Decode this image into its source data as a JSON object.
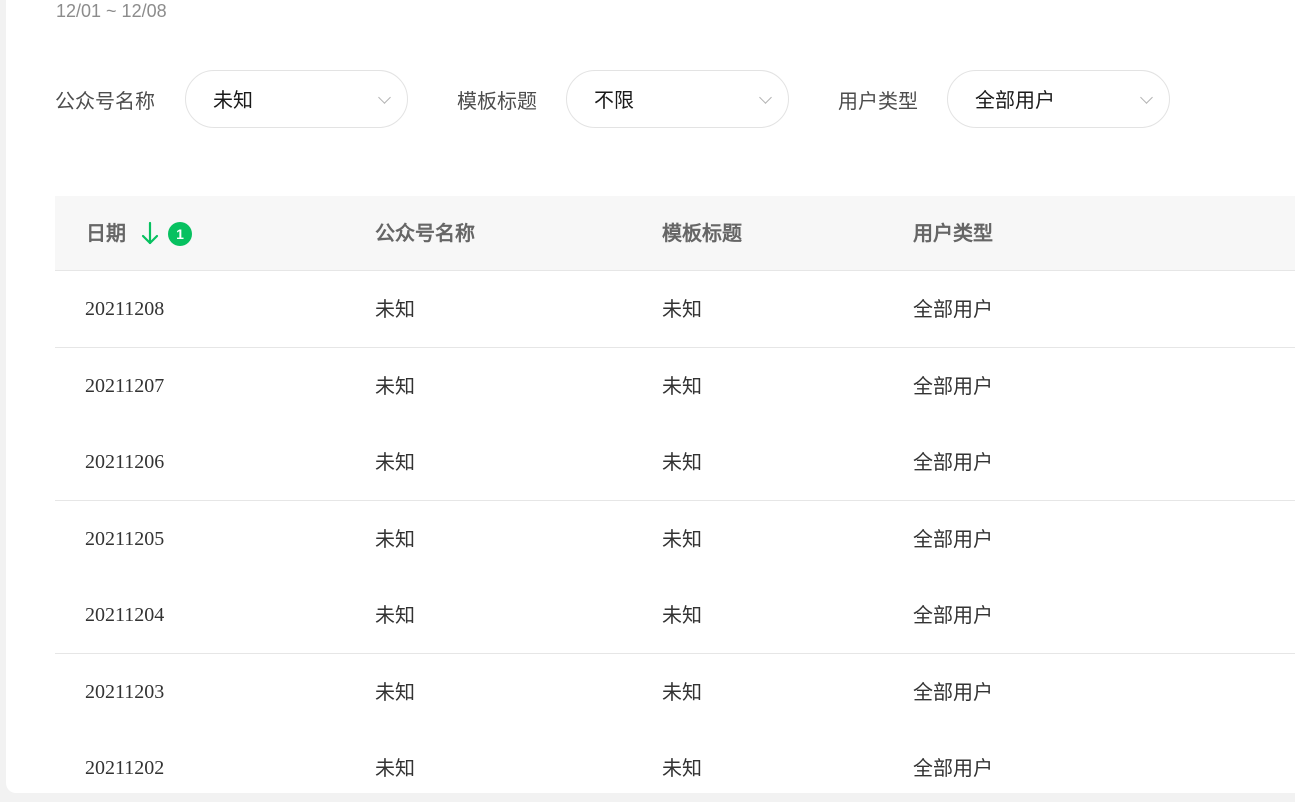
{
  "date_range": "12/01 ~ 12/08",
  "filters": [
    {
      "label": "公众号名称",
      "value": "未知"
    },
    {
      "label": "模板标题",
      "value": "不限"
    },
    {
      "label": "用户类型",
      "value": "全部用户"
    }
  ],
  "table": {
    "headers": [
      "日期",
      "公众号名称",
      "模板标题",
      "用户类型"
    ],
    "sort": {
      "column": "日期",
      "direction": "descending",
      "badge": "1"
    },
    "rows": [
      [
        "20211208",
        "未知",
        "未知",
        "全部用户"
      ],
      [
        "20211207",
        "未知",
        "未知",
        "全部用户"
      ],
      [
        "20211206",
        "未知",
        "未知",
        "全部用户"
      ],
      [
        "20211205",
        "未知",
        "未知",
        "全部用户"
      ],
      [
        "20211204",
        "未知",
        "未知",
        "全部用户"
      ],
      [
        "20211203",
        "未知",
        "未知",
        "全部用户"
      ],
      [
        "20211202",
        "未知",
        "未知",
        "全部用户"
      ]
    ]
  },
  "colors": {
    "accent": "#07c160",
    "header_bg": "#f7f7f7",
    "divider": "#e6e6e6"
  }
}
